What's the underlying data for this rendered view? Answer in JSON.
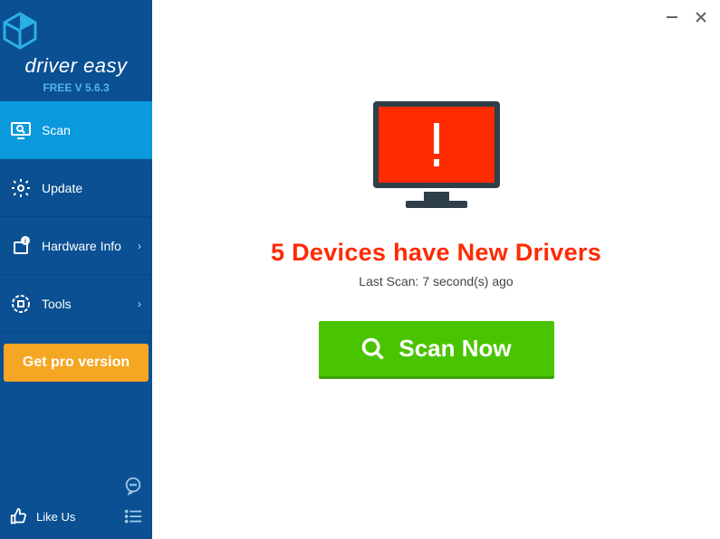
{
  "brand": {
    "name": "driver easy",
    "version": "FREE V 5.6.3"
  },
  "sidebar": {
    "items": [
      {
        "label": "Scan",
        "icon": "monitor-search-icon",
        "active": true,
        "expandable": false
      },
      {
        "label": "Update",
        "icon": "gear-icon",
        "active": false,
        "expandable": false
      },
      {
        "label": "Hardware Info",
        "icon": "chip-info-icon",
        "active": false,
        "expandable": true
      },
      {
        "label": "Tools",
        "icon": "tools-icon",
        "active": false,
        "expandable": true
      }
    ],
    "pro_label": "Get pro version",
    "like_label": "Like Us"
  },
  "main": {
    "headline": "5 Devices have New Drivers",
    "subline": "Last Scan: 7 second(s) ago",
    "scan_label": "Scan Now"
  },
  "colors": {
    "sidebar": "#0a5092",
    "active": "#0b99dd",
    "accent": "#f5a623",
    "danger": "#ff2a00",
    "scan": "#4ac400"
  }
}
